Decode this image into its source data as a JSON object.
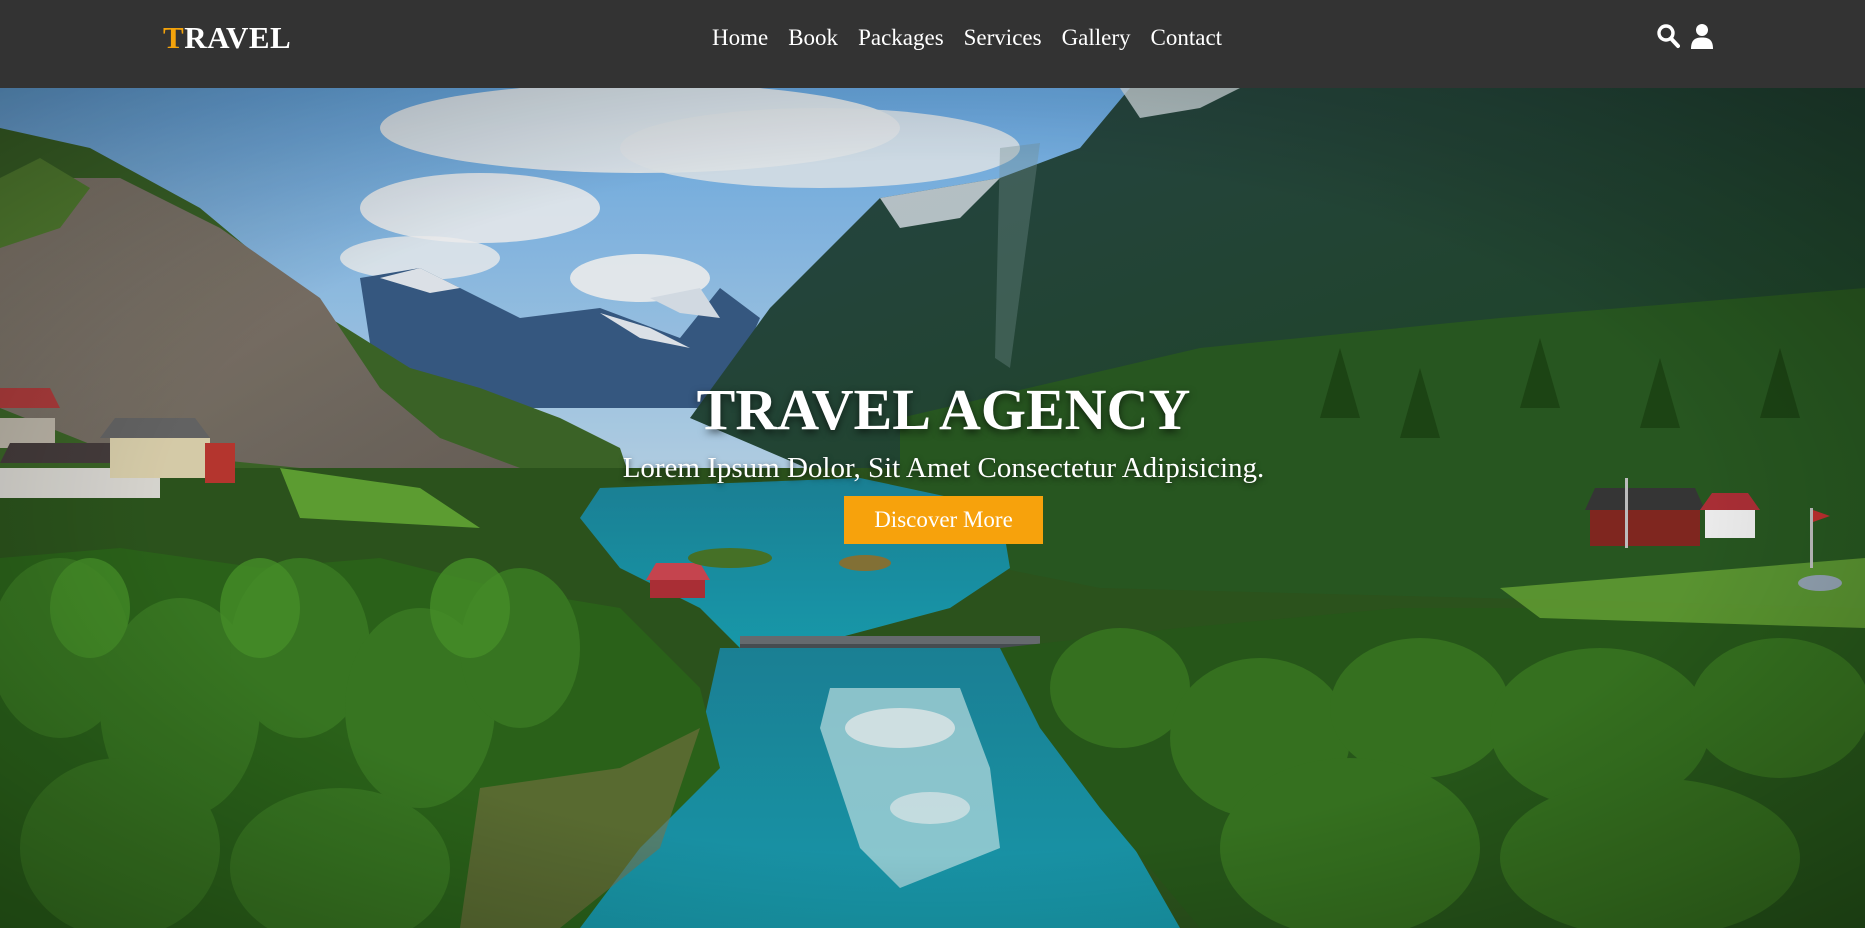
{
  "brand": {
    "first_letter": "T",
    "rest": "RAVEL"
  },
  "nav": {
    "links": [
      "Home",
      "Book",
      "Packages",
      "Services",
      "Gallery",
      "Contact"
    ],
    "icons": [
      "search-icon",
      "user-icon"
    ]
  },
  "hero": {
    "title": "TRAVEL AGENCY",
    "subtitle": "Lorem Ipsum Dolor, Sit Amet Consectetur Adipisicing.",
    "button_label": "Discover More"
  },
  "colors": {
    "navbar_bg": "#333333",
    "accent": "#f4a30b",
    "button_bg": "#f7a20c",
    "text": "#ffffff"
  }
}
